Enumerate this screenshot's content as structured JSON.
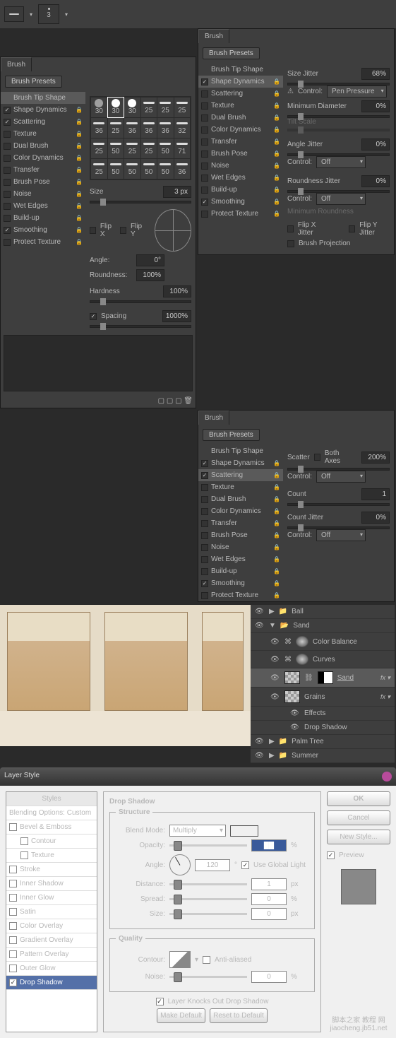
{
  "toolbar": {
    "size_value": "3"
  },
  "brush1": {
    "tab": "Brush",
    "presets_btn": "Brush Presets",
    "items": [
      "Brush Tip Shape",
      "Shape Dynamics",
      "Scattering",
      "Texture",
      "Dual Brush",
      "Color Dynamics",
      "Transfer",
      "Brush Pose",
      "Noise",
      "Wet Edges",
      "Build-up",
      "Smoothing",
      "Protect Texture"
    ],
    "checked": [
      null,
      true,
      true,
      false,
      false,
      false,
      false,
      false,
      false,
      false,
      false,
      true,
      false
    ],
    "grid_labels": [
      "30",
      "30",
      "30",
      "25",
      "25",
      "25",
      "36",
      "25",
      "36",
      "36",
      "36",
      "32",
      "25",
      "50",
      "25",
      "25",
      "50",
      "71",
      "25",
      "50",
      "50",
      "50",
      "50",
      "36"
    ],
    "size_lbl": "Size",
    "size_val": "3 px",
    "flipx": "Flip X",
    "flipy": "Flip Y",
    "angle_lbl": "Angle:",
    "angle_val": "0°",
    "round_lbl": "Roundness:",
    "round_val": "100%",
    "hard_lbl": "Hardness",
    "hard_val": "100%",
    "spacing_lbl": "Spacing",
    "spacing_val": "1000%"
  },
  "brush2": {
    "tab": "Brush",
    "presets_btn": "Brush Presets",
    "items": [
      "Brush Tip Shape",
      "Shape Dynamics",
      "Scattering",
      "Texture",
      "Dual Brush",
      "Color Dynamics",
      "Transfer",
      "Brush Pose",
      "Noise",
      "Wet Edges",
      "Build-up",
      "Smoothing",
      "Protect Texture"
    ],
    "checked": [
      null,
      true,
      false,
      false,
      false,
      false,
      false,
      false,
      false,
      false,
      false,
      true,
      false
    ],
    "size_jitter_lbl": "Size Jitter",
    "size_jitter_val": "68%",
    "ctrl_lbl": "Control:",
    "ctrl_val": "Pen Pressure",
    "min_dia_lbl": "Minimum Diameter",
    "min_dia_val": "0%",
    "tilt_lbl": "Tilt Scale",
    "angle_jitter_lbl": "Angle Jitter",
    "angle_jitter_val": "0%",
    "ctrl2_val": "Off",
    "round_jitter_lbl": "Roundness Jitter",
    "round_jitter_val": "0%",
    "ctrl3_val": "Off",
    "min_round_lbl": "Minimum Roundness",
    "flipxj": "Flip X Jitter",
    "flipyj": "Flip Y Jitter",
    "brush_proj": "Brush Projection"
  },
  "brush3": {
    "tab": "Brush",
    "presets_btn": "Brush Presets",
    "items": [
      "Brush Tip Shape",
      "Shape Dynamics",
      "Scattering",
      "Texture",
      "Dual Brush",
      "Color Dynamics",
      "Transfer",
      "Brush Pose",
      "Noise",
      "Wet Edges",
      "Build-up",
      "Smoothing",
      "Protect Texture"
    ],
    "checked": [
      null,
      true,
      true,
      false,
      false,
      false,
      false,
      false,
      false,
      false,
      false,
      true,
      false
    ],
    "scatter_lbl": "Scatter",
    "both_axes": "Both Axes",
    "scatter_val": "200%",
    "ctrl_lbl": "Control:",
    "ctrl_val": "Off",
    "count_lbl": "Count",
    "count_val": "1",
    "count_jitter_lbl": "Count Jitter",
    "count_jitter_val": "0%",
    "ctrl2_val": "Off"
  },
  "layers": {
    "items": [
      {
        "name": "Ball",
        "type": "folder",
        "sel": false
      },
      {
        "name": "Sand",
        "type": "folder",
        "sel": false,
        "expanded": true
      },
      {
        "name": "Color Balance",
        "type": "adj",
        "sel": false,
        "indent": 1
      },
      {
        "name": "Curves",
        "type": "adj",
        "sel": false,
        "indent": 1
      },
      {
        "name": "Sand",
        "type": "layer",
        "sel": true,
        "indent": 1,
        "fx": true
      },
      {
        "name": "Grains",
        "type": "layer",
        "sel": false,
        "indent": 1,
        "fx": true
      },
      {
        "name": "Effects",
        "type": "fxline",
        "indent": 2
      },
      {
        "name": "Drop Shadow",
        "type": "fxline",
        "indent": 2
      },
      {
        "name": "Palm Tree",
        "type": "folder",
        "sel": false
      },
      {
        "name": "Summer",
        "type": "folder",
        "sel": false
      }
    ]
  },
  "layer_style": {
    "title": "Layer Style",
    "list": [
      "Styles",
      "Blending Options: Custom",
      "Bevel & Emboss",
      "Contour",
      "Texture",
      "Stroke",
      "Inner Shadow",
      "Inner Glow",
      "Satin",
      "Color Overlay",
      "Gradient Overlay",
      "Pattern Overlay",
      "Outer Glow",
      "Drop Shadow"
    ],
    "checked": [
      null,
      null,
      false,
      false,
      false,
      false,
      false,
      false,
      false,
      false,
      false,
      false,
      false,
      true
    ],
    "section": "Drop Shadow",
    "structure": "Structure",
    "blend_mode_lbl": "Blend Mode:",
    "blend_mode_val": "Multiply",
    "swatch_color": "#3d2817",
    "opacity_lbl": "Opacity:",
    "opacity_unit": "%",
    "angle_lbl": "Angle:",
    "angle_val": "120",
    "angle_unit": "°",
    "global_light": "Use Global Light",
    "distance_lbl": "Distance:",
    "distance_val": "1",
    "distance_unit": "px",
    "spread_lbl": "Spread:",
    "spread_val": "0",
    "spread_unit": "%",
    "size_lbl": "Size:",
    "size_val": "0",
    "size_unit": "px",
    "quality": "Quality",
    "contour_lbl": "Contour:",
    "aa": "Anti-aliased",
    "noise_lbl": "Noise:",
    "noise_val": "0",
    "noise_unit": "%",
    "knockout": "Layer Knocks Out Drop Shadow",
    "make_default": "Make Default",
    "reset_default": "Reset to Default",
    "ok": "OK",
    "cancel": "Cancel",
    "new_style": "New Style...",
    "preview": "Preview"
  },
  "watermark": {
    "line1": "脚本之家 教程 网",
    "line2": "jiaocheng.jb51.net"
  }
}
